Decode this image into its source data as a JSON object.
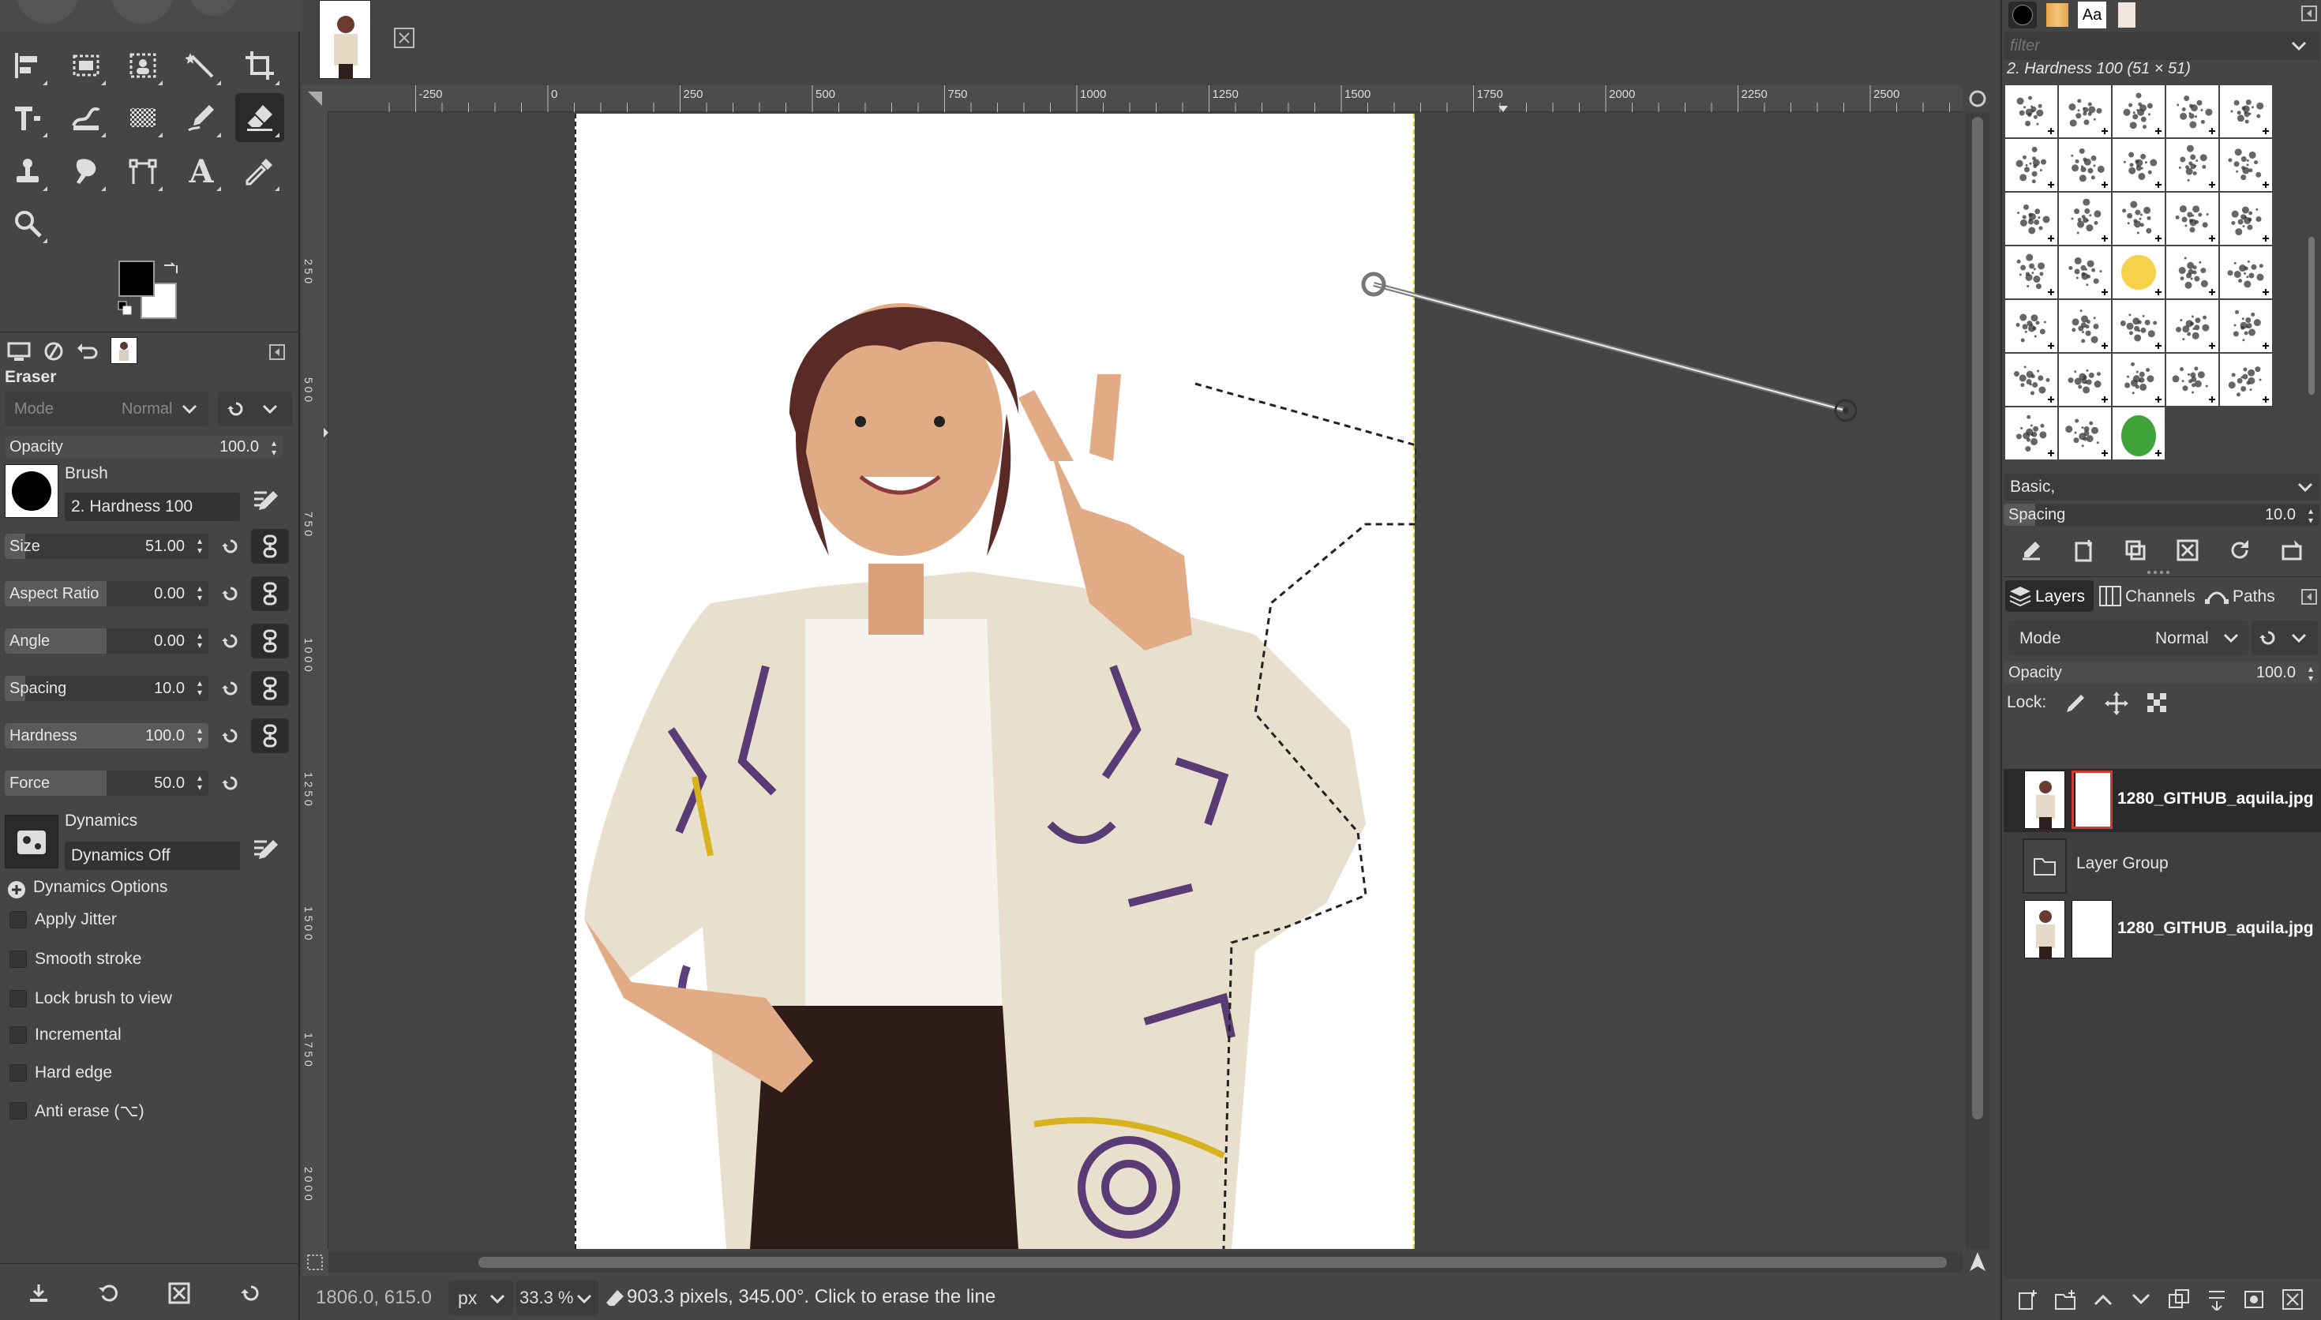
{
  "toolbox": {
    "tools": [
      {
        "name": "align-tool-icon"
      },
      {
        "name": "rect-select-icon"
      },
      {
        "name": "foreground-select-icon"
      },
      {
        "name": "fuzzy-select-icon"
      },
      {
        "name": "crop-icon"
      },
      {
        "name": "unified-transform-icon"
      },
      {
        "name": "warp-transform-icon"
      },
      {
        "name": "gradient-icon"
      },
      {
        "name": "ink-icon"
      },
      {
        "name": "eraser-icon"
      },
      {
        "name": "clone-icon"
      },
      {
        "name": "smudge-icon"
      },
      {
        "name": "paths-icon"
      },
      {
        "name": "text-icon"
      },
      {
        "name": "color-picker-icon"
      },
      {
        "name": "zoom-icon"
      }
    ],
    "fg_color": "#000000",
    "bg_color": "#ffffff"
  },
  "tool_options": {
    "title": "Eraser",
    "mode_label": "Mode",
    "mode_value": "Normal",
    "opacity_label": "Opacity",
    "opacity_value": "100.0",
    "brush_label": "Brush",
    "brush_name": "2. Hardness 100",
    "sliders": [
      {
        "label": "Size",
        "value": "51.00",
        "fill": 0.1
      },
      {
        "label": "Aspect Ratio",
        "value": "0.00",
        "fill": 0.5
      },
      {
        "label": "Angle",
        "value": "0.00",
        "fill": 0.5
      },
      {
        "label": "Spacing",
        "value": "10.0",
        "fill": 0.1
      },
      {
        "label": "Hardness",
        "value": "100.0",
        "fill": 1.0
      },
      {
        "label": "Force",
        "value": "50.0",
        "fill": 0.5
      }
    ],
    "dynamics_label": "Dynamics",
    "dynamics_value": "Dynamics Off",
    "dynamics_options_label": "Dynamics Options",
    "checkboxes": [
      "Apply Jitter",
      "Smooth stroke",
      "Lock brush to view",
      "Incremental",
      "Hard edge",
      "Anti erase  (⌥)"
    ]
  },
  "ruler": {
    "labels": [
      "-250",
      "0",
      "250",
      "500",
      "750",
      "1000",
      "1250",
      "1500",
      "1750",
      "2000",
      "2250",
      "2500"
    ],
    "values": [
      -250,
      0,
      250,
      500,
      750,
      1000,
      1250,
      1500,
      1750,
      2000,
      2250,
      2500
    ]
  },
  "status": {
    "coords": "1806.0, 615.0",
    "unit": "px",
    "zoom": "33.3 %",
    "message": "903.3 pixels, 345.00°. Click to erase the line"
  },
  "brushes_panel": {
    "filter_placeholder": "filter",
    "brush_title": "2. Hardness 100 (51 × 51)",
    "preset": "Basic,",
    "spacing_label": "Spacing",
    "spacing_value": "10.0"
  },
  "layers_panel": {
    "tabs": [
      "Layers",
      "Channels",
      "Paths"
    ],
    "mode_label": "Mode",
    "mode_value": "Normal",
    "opacity_label": "Opacity",
    "opacity_value": "100.0",
    "lock_label": "Lock:",
    "layers": [
      {
        "name": "1280_GITHUB_aquila.jpg",
        "bold": true
      },
      {
        "name": "Layer Group",
        "bold": false
      },
      {
        "name": "1280_GITHUB_aquila.jpg",
        "bold": true
      }
    ]
  },
  "colors": {
    "panel": "#454545",
    "canvas_bg": "#454545",
    "accent_red": "#d33a2f"
  }
}
